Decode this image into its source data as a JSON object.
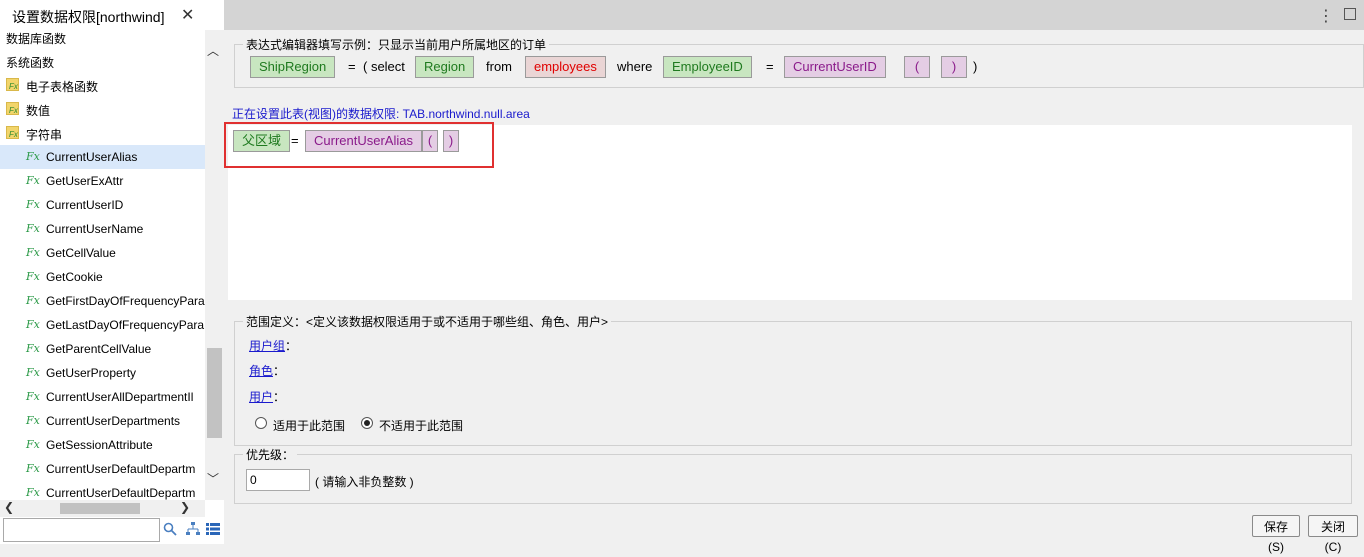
{
  "tab": {
    "title": "设置数据权限[northwind]"
  },
  "tree": {
    "items": [
      {
        "label": "数据库函数",
        "kind": "header"
      },
      {
        "label": "系统函数",
        "kind": "header"
      },
      {
        "label": "电子表格函数",
        "kind": "folder"
      },
      {
        "label": "数值",
        "kind": "folder"
      },
      {
        "label": "字符串",
        "kind": "folder"
      },
      {
        "label": "CurrentUserAlias",
        "kind": "fn",
        "selected": true
      },
      {
        "label": "GetUserExAttr",
        "kind": "fn"
      },
      {
        "label": "CurrentUserID",
        "kind": "fn"
      },
      {
        "label": "CurrentUserName",
        "kind": "fn"
      },
      {
        "label": "GetCellValue",
        "kind": "fn"
      },
      {
        "label": "GetCookie",
        "kind": "fn"
      },
      {
        "label": "GetFirstDayOfFrequencyPara",
        "kind": "fn"
      },
      {
        "label": "GetLastDayOfFrequencyPara",
        "kind": "fn"
      },
      {
        "label": "GetParentCellValue",
        "kind": "fn"
      },
      {
        "label": "GetUserProperty",
        "kind": "fn"
      },
      {
        "label": "CurrentUserAllDepartmentIl",
        "kind": "fn"
      },
      {
        "label": "CurrentUserDepartments",
        "kind": "fn"
      },
      {
        "label": "GetSessionAttribute",
        "kind": "fn"
      },
      {
        "label": "CurrentUserDefaultDepartm",
        "kind": "fn"
      },
      {
        "label": "CurrentUserDefaultDepartm",
        "kind": "fn"
      }
    ],
    "folder_icon_text": "Fx",
    "fn_icon_text": "Fx"
  },
  "example": {
    "legend": "表达式编辑器填写示例：只显示当前用户所属地区的订单",
    "tokens": {
      "t1": "ShipRegion",
      "t2": "=",
      "t3": "( select",
      "t4": "Region",
      "t5": "from",
      "t6": "employees",
      "t7": "where",
      "t8": "EmployeeID",
      "t9": "=",
      "t10": "CurrentUserID",
      "t11": "(",
      "t12": ")",
      "t13": ")"
    }
  },
  "editor": {
    "setting_label": "正在设置此表(视图)的数据权限: TAB.northwind.null.area",
    "tokens": {
      "e1": "父区域",
      "e2": "=",
      "e3": "CurrentUserAlias",
      "e4": "(",
      "e5": ")"
    }
  },
  "scope": {
    "legend": "范围定义：<定义该数据权限适用于或不适用于哪些组、角色、用户>",
    "user_group": "用户组",
    "role": "角色",
    "user": "用户",
    "colon": "：",
    "apply_label": "适用于此范围",
    "not_apply_label": "不适用于此范围",
    "selected": "not_apply"
  },
  "priority": {
    "legend": "优先级：",
    "value": "0",
    "hint": "( 请输入非负整数 )"
  },
  "buttons": {
    "save": "保存(S)",
    "close": "关闭(C)"
  },
  "colors": {
    "selection": "#d9e8fa",
    "link": "#1a1acd",
    "highlight_box": "#e03030"
  },
  "icons": {
    "menu": "⋮",
    "close": "✕",
    "scroll_up": "︿",
    "scroll_down": "﹀",
    "scroll_left": "❮",
    "scroll_right": "❯"
  }
}
